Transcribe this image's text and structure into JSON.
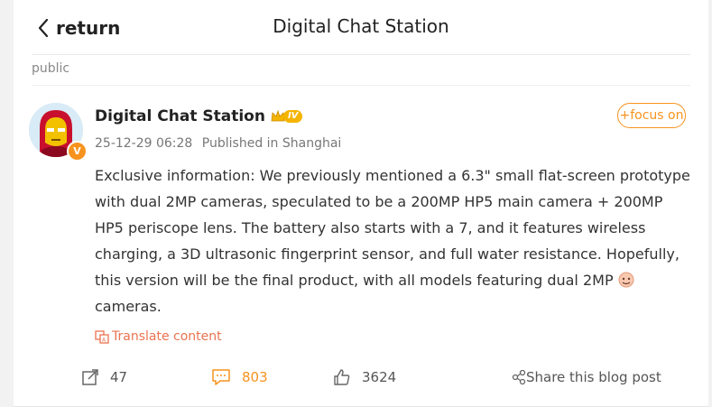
{
  "header": {
    "back_label": "return",
    "title": "Digital Chat Station"
  },
  "post": {
    "visibility": "public",
    "author": "Digital Chat Station",
    "level": "IV",
    "follow_label": "+focus on",
    "timestamp": "25-12-29 06:28",
    "location": "Published in Shanghai",
    "body": "Exclusive information: We previously mentioned a 6.3\" small flat-screen prototype with dual 2MP cameras, speculated to be a 200MP HP5 main camera + 200MP HP5 periscope lens. The battery also starts with a 7, and it features wireless charging, a 3D ultrasonic fingerprint sensor, and full water resistance. Hopefully, this version will be the final product, with all models featuring dual 2MP",
    "body_tail": "cameras.",
    "translate_label": "Translate content",
    "verified_badge": "V"
  },
  "actions": {
    "repost_count": "47",
    "comment_count": "803",
    "like_count": "3624",
    "share_label": "Share this blog post"
  },
  "colors": {
    "accent": "#f7931e",
    "translate": "#eb7350",
    "background": "#f2f2f2"
  },
  "icons": {
    "back": "chevron-left-icon",
    "repost": "repost-icon",
    "comment": "comment-icon",
    "like": "thumbs-up-icon",
    "share": "share-icon",
    "translate": "translate-icon",
    "crown": "crown-icon",
    "emoji": "emoji-icon"
  }
}
